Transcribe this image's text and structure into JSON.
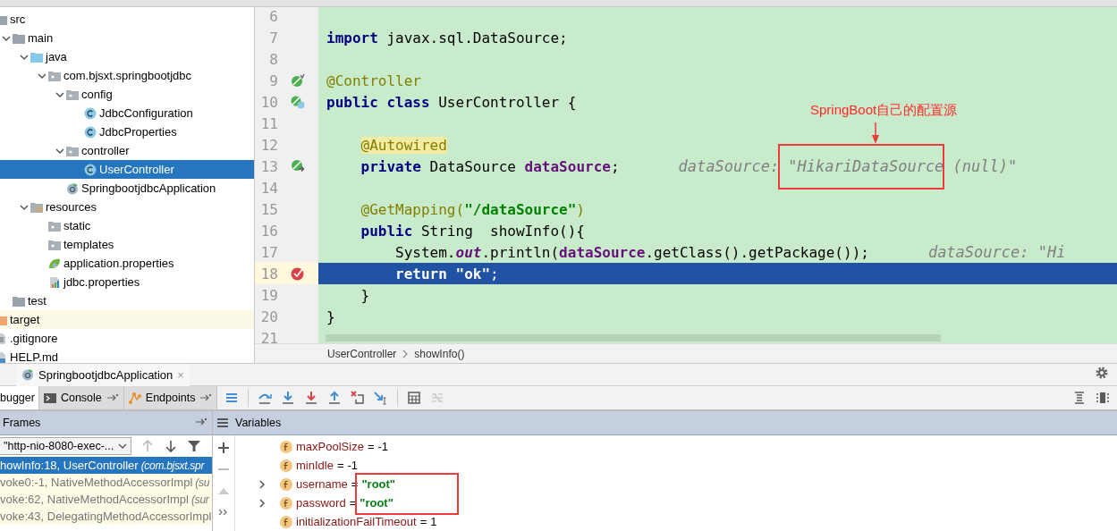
{
  "project_tree": [
    {
      "label": "src",
      "kind": "folder",
      "selected": false,
      "children": [
        {
          "label": "main",
          "kind": "folder",
          "expanded": true,
          "selected": false,
          "children": [
            {
              "label": "java",
              "kind": "source-folder",
              "expanded": true,
              "selected": false,
              "children": [
                {
                  "label": "com.bjsxt.springbootjdbc",
                  "kind": "package",
                  "expanded": true,
                  "selected": false,
                  "children": [
                    {
                      "label": "config",
                      "kind": "package",
                      "expanded": true,
                      "selected": false,
                      "children": [
                        {
                          "label": "JdbcConfiguration",
                          "kind": "class",
                          "selected": false
                        },
                        {
                          "label": "JdbcProperties",
                          "kind": "class",
                          "selected": false
                        }
                      ]
                    },
                    {
                      "label": "controller",
                      "kind": "package",
                      "expanded": true,
                      "selected": false,
                      "children": [
                        {
                          "label": "UserController",
                          "kind": "class",
                          "selected": true
                        }
                      ]
                    },
                    {
                      "label": "SpringbootjdbcApplication",
                      "kind": "spring-class",
                      "selected": false
                    }
                  ]
                }
              ]
            },
            {
              "label": "resources",
              "kind": "resources-folder",
              "expanded": true,
              "selected": false,
              "children": [
                {
                  "label": "static",
                  "kind": "package",
                  "selected": false
                },
                {
                  "label": "templates",
                  "kind": "package",
                  "selected": false
                },
                {
                  "label": "application.properties",
                  "kind": "spring-properties",
                  "selected": false
                },
                {
                  "label": "jdbc.properties",
                  "kind": "properties",
                  "selected": false
                }
              ]
            }
          ]
        },
        {
          "label": "test",
          "kind": "folder",
          "selected": false
        }
      ]
    },
    {
      "label": "target",
      "kind": "excluded-folder",
      "selected": false
    },
    {
      "label": ".gitignore",
      "kind": "text-file",
      "selected": false
    },
    {
      "label": "HELP.md",
      "kind": "markdown-file",
      "selected": false
    }
  ],
  "editor": {
    "lines": [
      {
        "number": "6",
        "current": false
      },
      {
        "number": "7",
        "current": false,
        "tokens": [
          {
            "kind": "keyword",
            "text": "import"
          },
          {
            "kind": "plain",
            "text": " javax.sql.DataSource;"
          }
        ]
      },
      {
        "number": "8",
        "current": false
      },
      {
        "number": "9",
        "current": false,
        "gutter": {
          "kind": "bean"
        },
        "tokens": [
          {
            "kind": "annotation",
            "text": "@Controller"
          }
        ]
      },
      {
        "number": "10",
        "current": false,
        "gutter": {
          "kind": "class"
        },
        "tokens": [
          {
            "kind": "keyword",
            "text": "public class"
          },
          {
            "kind": "plain",
            "text": " UserController {"
          }
        ]
      },
      {
        "number": "11",
        "current": false
      },
      {
        "number": "12",
        "current": false,
        "tokens": [
          {
            "kind": "annotation-highlighted",
            "text": "    @Autowired"
          }
        ]
      },
      {
        "number": "13",
        "current": false,
        "gutter": {
          "kind": "autowired"
        },
        "tokens": [
          {
            "kind": "keyword",
            "text": "    private"
          },
          {
            "kind": "plain",
            "text": " DataSource "
          },
          {
            "kind": "field",
            "text": "dataSource"
          },
          {
            "kind": "plain",
            "text": ";"
          }
        ],
        "hint": "dataSource: \"HikariDataSource (null)\""
      },
      {
        "number": "14",
        "current": false
      },
      {
        "number": "15",
        "current": false,
        "tokens": [
          {
            "kind": "annotation",
            "text": "    @GetMapping("
          },
          {
            "kind": "string",
            "text": "\"/dataSource\""
          },
          {
            "kind": "annotation",
            "text": ")"
          }
        ]
      },
      {
        "number": "16",
        "current": false,
        "tokens": [
          {
            "kind": "keyword",
            "text": "    public"
          },
          {
            "kind": "plain",
            "text": " String  showInfo(){"
          }
        ]
      },
      {
        "number": "17",
        "current": false,
        "tokens": [
          {
            "kind": "plain",
            "text": "        System."
          },
          {
            "kind": "static",
            "text": "out"
          },
          {
            "kind": "plain",
            "text": ".println("
          },
          {
            "kind": "field",
            "text": "dataSource"
          },
          {
            "kind": "plain",
            "text": ".getClass().getPackage());"
          }
        ],
        "hint": "dataSource: \"Hi"
      },
      {
        "number": "18",
        "current": true,
        "gutter": {
          "kind": "breakpoint"
        },
        "tokens": [
          {
            "kind": "keyword",
            "text": "        return"
          },
          {
            "kind": "string",
            "text": " \"ok\""
          },
          {
            "kind": "plain",
            "text": ";"
          }
        ]
      },
      {
        "number": "19",
        "current": false,
        "tokens": [
          {
            "kind": "plain",
            "text": "    }"
          }
        ]
      },
      {
        "number": "20",
        "current": false,
        "tokens": [
          {
            "kind": "plain",
            "text": "}"
          }
        ]
      },
      {
        "number": "21",
        "current": false
      }
    ],
    "callout": "SpringBoot自己的配置源",
    "breadcrumbs": [
      "UserController",
      "showInfo()"
    ]
  },
  "run_tab": {
    "label": "SpringbootjdbcApplication",
    "close": "×"
  },
  "debug_tabs": [
    {
      "label": "bugger",
      "kind": "debugger",
      "selected": true
    },
    {
      "label": "Console",
      "kind": "console",
      "selected": false
    },
    {
      "label": "Endpoints",
      "kind": "endpoints",
      "selected": false
    }
  ],
  "frames_panel": {
    "title": "Frames",
    "thread": "\"http-nio-8080-exec-...",
    "frames": [
      {
        "location": "howInfo:18, UserController",
        "package": "(com.bjsxt.spr",
        "selected": true
      },
      {
        "location": "voke0:-1, NativeMethodAccessorImpl",
        "package": "(su",
        "selected": false
      },
      {
        "location": "voke:62, NativeMethodAccessorImpl",
        "package": "(sur",
        "selected": false
      },
      {
        "location": "voke:43, DelegatingMethodAccessorImpl",
        "selected": false
      }
    ]
  },
  "variables_panel": {
    "title": "Variables",
    "variables": [
      {
        "name": "maxPoolSize",
        "operator": "=",
        "value": "-1",
        "kind": "number",
        "expandable": false
      },
      {
        "name": "minIdle",
        "operator": "=",
        "value": "-1",
        "kind": "number",
        "expandable": false
      },
      {
        "name": "username",
        "operator": "=",
        "value": "\"root\"",
        "kind": "string",
        "expandable": true
      },
      {
        "name": "password",
        "operator": "=",
        "value": "\"root\"",
        "kind": "string",
        "expandable": true
      },
      {
        "name": "initializationFailTimeout",
        "operator": "=",
        "value": "1",
        "kind": "number",
        "expandable": false
      }
    ]
  }
}
